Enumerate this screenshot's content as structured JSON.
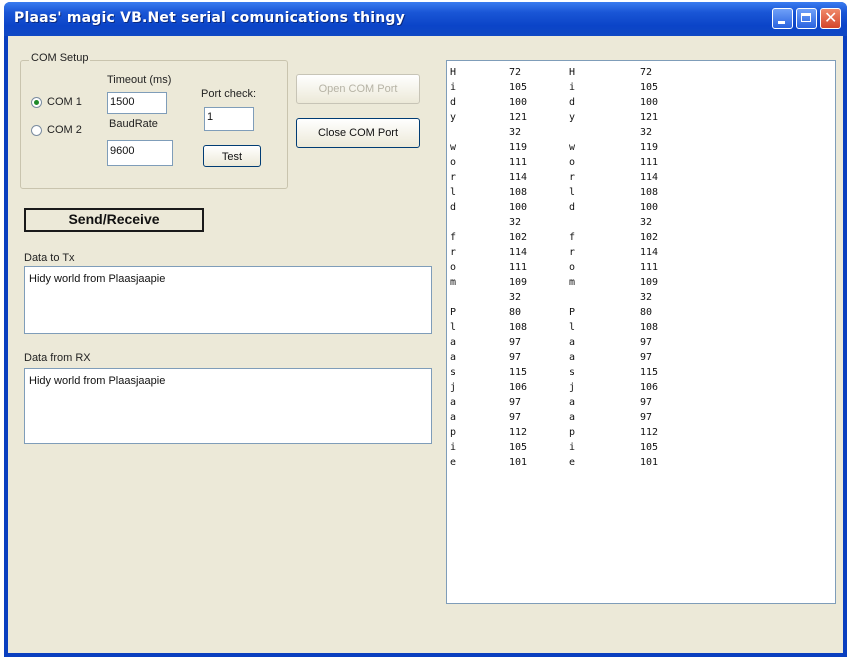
{
  "window": {
    "title": "Plaas' magic VB.Net serial comunications thingy",
    "controls": [
      "minimize-icon",
      "maximize-icon",
      "close-icon"
    ],
    "close_glyph": "✕"
  },
  "com_setup": {
    "group_label": "COM Setup",
    "com1_label": "COM 1",
    "com2_label": "COM 2",
    "selected": "COM 1",
    "timeout_label": "Timeout (ms)",
    "timeout_value": "1500",
    "baudrate_label": "BaudRate",
    "baudrate_value": "9600",
    "port_check_label": "Port check:",
    "port_check_value": "1",
    "test_button": "Test"
  },
  "port_buttons": {
    "open": "Open COM Port",
    "close": "Close COM Port"
  },
  "send_receive_button": "Send/Receive",
  "tx": {
    "label": "Data to Tx",
    "value": "Hidy world from Plaasjaapie"
  },
  "rx": {
    "label": "Data from RX",
    "value": "Hidy world from Plaasjaapie"
  },
  "log_rows": [
    [
      "H",
      "72",
      "H",
      "72"
    ],
    [
      "i",
      "105",
      "i",
      "105"
    ],
    [
      "d",
      "100",
      "d",
      "100"
    ],
    [
      "y",
      "121",
      "y",
      "121"
    ],
    [
      "",
      "32",
      "",
      "32"
    ],
    [
      "w",
      "119",
      "w",
      "119"
    ],
    [
      "o",
      "111",
      "o",
      "111"
    ],
    [
      "r",
      "114",
      "r",
      "114"
    ],
    [
      "l",
      "108",
      "l",
      "108"
    ],
    [
      "d",
      "100",
      "d",
      "100"
    ],
    [
      "",
      "32",
      "",
      "32"
    ],
    [
      "f",
      "102",
      "f",
      "102"
    ],
    [
      "r",
      "114",
      "r",
      "114"
    ],
    [
      "o",
      "111",
      "o",
      "111"
    ],
    [
      "m",
      "109",
      "m",
      "109"
    ],
    [
      "",
      "32",
      "",
      "32"
    ],
    [
      "P",
      "80",
      "P",
      "80"
    ],
    [
      "l",
      "108",
      "l",
      "108"
    ],
    [
      "a",
      "97",
      "a",
      "97"
    ],
    [
      "a",
      "97",
      "a",
      "97"
    ],
    [
      "s",
      "115",
      "s",
      "115"
    ],
    [
      "j",
      "106",
      "j",
      "106"
    ],
    [
      "a",
      "97",
      "a",
      "97"
    ],
    [
      "a",
      "97",
      "a",
      "97"
    ],
    [
      "p",
      "112",
      "p",
      "112"
    ],
    [
      "i",
      "105",
      "i",
      "105"
    ],
    [
      "e",
      "101",
      "e",
      "101"
    ]
  ]
}
